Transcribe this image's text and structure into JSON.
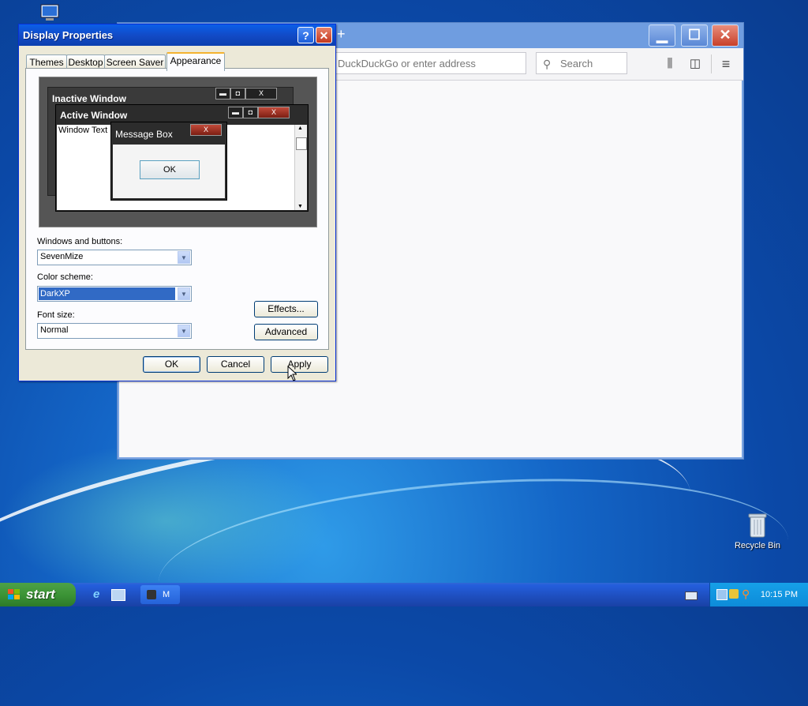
{
  "desktop": {
    "recycle_bin_label": "Recycle Bin"
  },
  "browser": {
    "new_tab": "+",
    "url_placeholder": "DuckDuckGo or enter address",
    "search_placeholder": "Search",
    "minimize_glyph": "▁",
    "maximize_glyph": "☐",
    "close_glyph": "✕",
    "library_glyph": "⫼",
    "sidebar_glyph": "◫",
    "menu_glyph": "≡"
  },
  "dialog": {
    "title": "Display Properties",
    "help_glyph": "?",
    "close_glyph": "✕",
    "tabs": [
      "Themes",
      "Desktop",
      "Screen Saver",
      "Appearance"
    ],
    "active_tab": "Appearance",
    "preview": {
      "inactive_title": "Inactive Window",
      "active_title": "Active Window",
      "window_text": "Window Text",
      "message_title": "Message Box",
      "message_ok": "OK",
      "btn_min": "▬",
      "btn_max": "◘",
      "btn_close": "X"
    },
    "windows_buttons_label": "Windows and buttons:",
    "windows_buttons_value": "SevenMize",
    "color_scheme_label": "Color scheme:",
    "color_scheme_value": "DarkXP",
    "font_size_label": "Font size:",
    "font_size_value": "Normal",
    "effects_label": "Effects...",
    "advanced_label": "Advanced",
    "ok_label": "OK",
    "cancel_label": "Cancel",
    "apply_label": "Apply",
    "dropdown_glyph": "▼"
  },
  "taskbar": {
    "start_label": "start",
    "task_label": "M",
    "clock": "10:15 PM"
  }
}
